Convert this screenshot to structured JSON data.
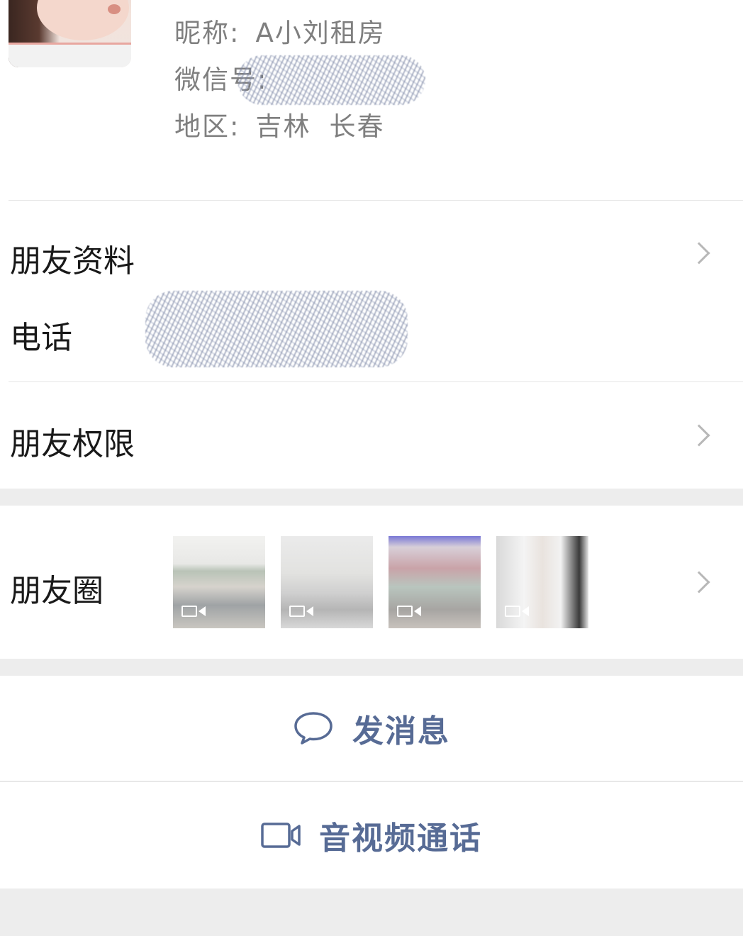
{
  "profile": {
    "nickname_label": "昵称:",
    "nickname": "A小刘租房",
    "wechat_label": "微信号:",
    "region_label": "地区:",
    "region_province": "吉林",
    "region_city": "长春"
  },
  "rows": {
    "friend_info": "朋友资料",
    "phone": "电话",
    "friend_permission": "朋友权限",
    "moments": "朋友圈"
  },
  "moments_thumbs": [
    {
      "icon": "video-icon"
    },
    {
      "icon": "video-icon"
    },
    {
      "icon": "video-icon"
    },
    {
      "icon": "video-icon"
    }
  ],
  "actions": {
    "send_message": "发消息",
    "av_call": "音视频通话"
  },
  "colors": {
    "link": "#576b95",
    "background": "#ededed",
    "card": "#ffffff"
  }
}
